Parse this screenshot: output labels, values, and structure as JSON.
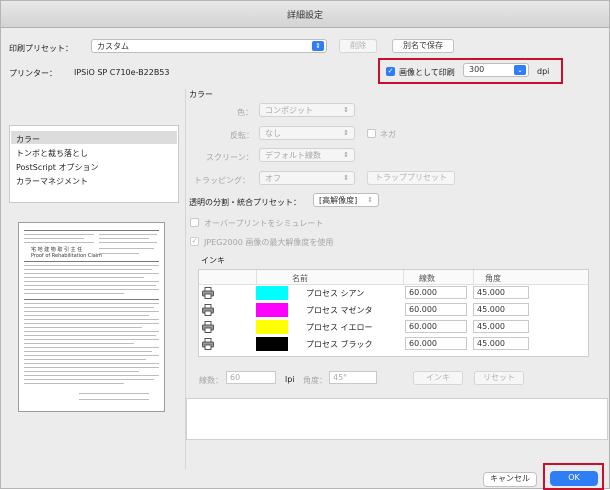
{
  "window": {
    "title": "詳細設定"
  },
  "top": {
    "preset_label": "印刷プリセット：",
    "preset_value": "カスタム",
    "delete_button": "削除",
    "save_as_button": "別名で保存",
    "printer_label": "プリンター：",
    "printer_value": "IPSiO SP C710e-B22B53",
    "print_as_image_label": "画像として印刷",
    "print_as_image_checked": true,
    "dpi_value": "300",
    "dpi_unit": "dpi"
  },
  "sidebar": {
    "items": [
      {
        "label": "カラー",
        "selected": true
      },
      {
        "label": "トンボと裁ち落とし",
        "selected": false
      },
      {
        "label": "PostScript オプション",
        "selected": false
      },
      {
        "label": "カラーマネジメント",
        "selected": false
      }
    ]
  },
  "color_section": {
    "heading": "カラー",
    "color_label": "色：",
    "color_value": "コンポジット",
    "invert_label": "反転：",
    "invert_value": "なし",
    "negative_label": "ネガ",
    "screen_label": "スクリーン：",
    "screen_value": "デフォルト線数",
    "trapping_label": "トラッピング：",
    "trapping_value": "オフ",
    "trap_preset_button": "トラッププリセット",
    "flatten_label": "透明の分割・統合プリセット：",
    "flatten_value": "[高解像度]",
    "overprint_label": "オーバープリントをシミュレート",
    "jpeg2000_label": "JPEG2000 画像の最大解像度を使用"
  },
  "ink": {
    "heading": "インキ",
    "columns": [
      "名前",
      "線数",
      "角度"
    ],
    "rows": [
      {
        "name": "プロセス シアン",
        "color": "#00ffff",
        "frequency": "60.000",
        "angle": "45.000"
      },
      {
        "name": "プロセス マゼンタ",
        "color": "#ff00ff",
        "frequency": "60.000",
        "angle": "45.000"
      },
      {
        "name": "プロセス イエロー",
        "color": "#ffff00",
        "frequency": "60.000",
        "angle": "45.000"
      },
      {
        "name": "プロセス ブラック",
        "color": "#000000",
        "frequency": "60.000",
        "angle": "45.000"
      }
    ],
    "freq_label": "線数：",
    "freq_value": "60",
    "lpi_label": "lpi",
    "angle_label": "角度：",
    "angle_value": "45°",
    "ink_button": "インキ",
    "reset_button": "リセット"
  },
  "footer": {
    "cancel_button": "キャンセル",
    "ok_button": "OK"
  },
  "colors": {
    "accent": "#2f7ef6",
    "highlight": "#c8102e"
  },
  "preview": {
    "doc_title": "宅 地 建 物 取 引 主 任",
    "doc_subtitle": "Proof of Rehabilitation Claim"
  }
}
